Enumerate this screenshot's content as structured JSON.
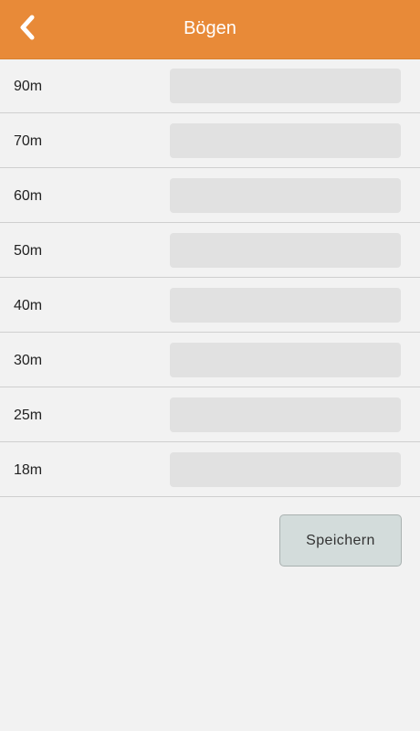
{
  "header": {
    "title": "Bögen",
    "back_icon": "chevron-left-icon"
  },
  "distances": [
    {
      "label": "90m",
      "value": ""
    },
    {
      "label": "70m",
      "value": ""
    },
    {
      "label": "60m",
      "value": ""
    },
    {
      "label": "50m",
      "value": ""
    },
    {
      "label": "40m",
      "value": ""
    },
    {
      "label": "30m",
      "value": ""
    },
    {
      "label": "25m",
      "value": ""
    },
    {
      "label": "18m",
      "value": ""
    }
  ],
  "save_button": {
    "label": "Speichern"
  },
  "colors": {
    "header_bg": "#e88a38",
    "page_bg": "#f2f2f2",
    "input_bg": "#e1e1e1",
    "button_bg": "#d3dcdb"
  }
}
